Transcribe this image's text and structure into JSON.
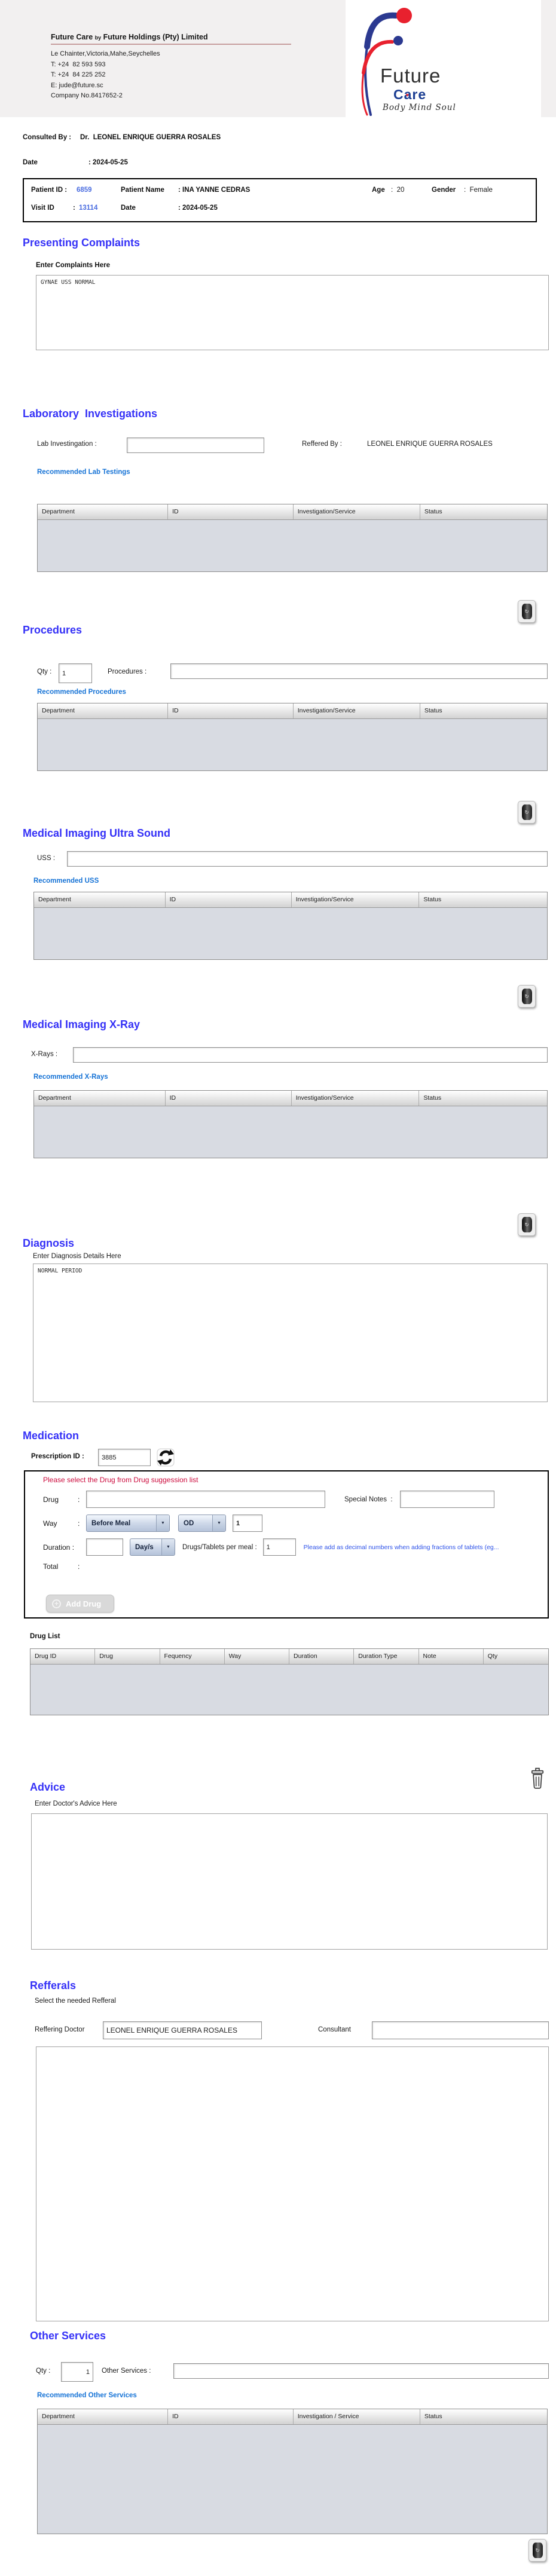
{
  "colors": {
    "section_title": "#3531f7",
    "link_blue": "#1673d6",
    "id_blue": "#4b6de0",
    "warning_red": "#cc0a3c",
    "note_blue": "#2b50e8",
    "table_body": "#d8dbe2",
    "header_band": "#f2f0f0"
  },
  "icons": {
    "dropdown_arrow": "▼",
    "trash_glyph": "↻",
    "plus": "+",
    "trash": "trash-can",
    "refresh": "circular-arrows"
  },
  "header": {
    "company_title_1": "Future Care ",
    "company_title_by": "by",
    "company_title_2": " Future Holdings (Pty) Limited",
    "address": "Le Chainter,Victoria,Mahe,Seychelles",
    "phone1": "T: +24  82 593 593",
    "phone2": "T: +24  84 225 252",
    "email": "E: jude@future.sc",
    "company_no": "Company No.8417652-2",
    "logo_line1": "Future",
    "logo_care_c": "C",
    "logo_care_a": "a",
    "logo_care_re": "re",
    "logo_heart": "♥",
    "logo_tagline": "Body Mind Soul",
    "consulted_by_label": "Consulted By :",
    "consulted_by_value": "Dr.  LEONEL ENRIQUE GUERRA ROSALES",
    "date_label": "Date",
    "date_value": ": 2024-05-25"
  },
  "patient": {
    "patient_id_label": "Patient ID :",
    "patient_id": "6859",
    "patient_name_label": "Patient Name",
    "patient_name": ": INA YANNE CEDRAS",
    "age_label": "Age",
    "age": ":  20",
    "gender_label": "Gender",
    "gender": ":  Female",
    "visit_id_label": "Visit ID",
    "visit_id_colon": ":",
    "visit_id": "13114",
    "visit_date_label": "Date",
    "visit_date": ": 2024-05-25"
  },
  "presenting_complaints": {
    "title": "Presenting Complaints",
    "sub_label": "Enter Complaints Here",
    "value": "GYNAE USS NORMAL"
  },
  "lab": {
    "title": "Laboratory  Investigations",
    "field_label": "Lab Investingation :",
    "field_value": "",
    "reffered_by_label": "Reffered By :",
    "reffered_by_value": "LEONEL ENRIQUE GUERRA ROSALES",
    "link": "Recommended Lab Testings",
    "table_headers": [
      "Department",
      "ID",
      "Investigation/Service",
      "Status"
    ]
  },
  "procedures": {
    "title": "Procedures",
    "qty_label": "Qty :",
    "qty_value": "1",
    "field_label": "Procedures :",
    "field_value": "",
    "link": "Recommended Procedures",
    "table_headers": [
      "Department",
      "ID",
      "Investigation/Service",
      "Status"
    ]
  },
  "uss": {
    "title": "Medical Imaging Ultra Sound",
    "field_label": "USS :",
    "field_value": "",
    "link": "Recommended USS",
    "table_headers": [
      "Department",
      "ID",
      "Investigation/Service",
      "Status"
    ]
  },
  "xray": {
    "title": "Medical Imaging X-Ray",
    "field_label": "X-Rays :",
    "field_value": "",
    "link": "Recommended X-Rays",
    "table_headers": [
      "Department",
      "ID",
      "Investigation/Service",
      "Status"
    ]
  },
  "diagnosis": {
    "title": "Diagnosis",
    "sub_label": "Enter Diagnosis Details Here",
    "value": "NORMAL PERIOD"
  },
  "medication": {
    "title": "Medication",
    "prescription_id_label": "Prescription ID :",
    "prescription_id": "3885",
    "warning": "Please select the Drug from Drug suggession list",
    "drug_label": "Drug",
    "drug_value": "",
    "special_notes_label": "Special Notes  :",
    "special_notes_value": "",
    "way_label": "Way",
    "colon": ":",
    "way_meal": "Before Meal",
    "way_frequency": "OD",
    "way_qty": "1",
    "duration_label": "Duration :",
    "duration_value": "",
    "duration_unit": "Day/s",
    "per_meal_label": "Drugs/Tablets per meal :",
    "per_meal_value": "1",
    "note": "Please add as decimal numbers when adding fractions of tablets (eg...",
    "total_label": "Total",
    "add_drug_label": "Add Drug",
    "drug_list_label": "Drug List",
    "drug_table_headers": [
      "Drug ID",
      "Drug",
      "Fequency",
      "Way",
      "Duration",
      "Duration Type",
      "Note",
      "Qty"
    ]
  },
  "advice": {
    "title": "Advice",
    "sub_label": "Enter Doctor's Advice Here",
    "value": ""
  },
  "refferals": {
    "title": "Refferals",
    "sub_label": "Select the needed Refferal",
    "reffering_doctor_label": "Reffering Doctor",
    "reffering_doctor_value": "LEONEL ENRIQUE GUERRA ROSALES",
    "consultant_label": "Consultant",
    "consultant_value": ""
  },
  "other_services": {
    "title": "Other Services",
    "qty_label": "Qty :",
    "qty_value": "1",
    "field_label": "Other Services :",
    "field_value": "",
    "link": "Recommended Other Services",
    "table_headers": [
      "Department",
      "ID",
      "Investigation / Service",
      "Status"
    ]
  }
}
